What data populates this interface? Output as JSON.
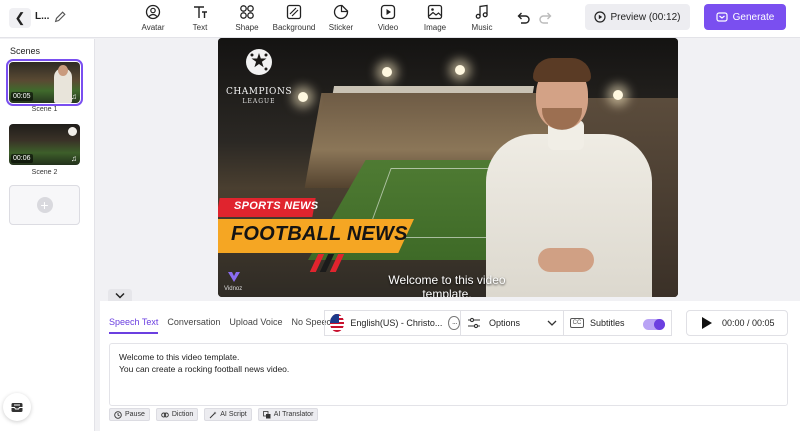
{
  "header": {
    "back_icon": "chevron-left-icon",
    "project_title": "L...",
    "tools": [
      {
        "label": "Avatar",
        "icon": "avatar-icon"
      },
      {
        "label": "Text",
        "icon": "text-icon"
      },
      {
        "label": "Shape",
        "icon": "shape-icon"
      },
      {
        "label": "Background",
        "icon": "background-icon"
      },
      {
        "label": "Sticker",
        "icon": "sticker-icon"
      },
      {
        "label": "Video",
        "icon": "video-icon"
      },
      {
        "label": "Image",
        "icon": "image-icon"
      },
      {
        "label": "Music",
        "icon": "music-icon"
      }
    ],
    "preview_label": "Preview (00:12)",
    "generate_label": "Generate"
  },
  "scenes": {
    "title": "Scenes",
    "items": [
      {
        "label": "Scene 1",
        "duration": "00:05",
        "selected": true
      },
      {
        "label": "Scene 2",
        "duration": "00:06",
        "selected": false
      }
    ]
  },
  "canvas": {
    "logo_title": "CHAMPIONS",
    "logo_subtitle": "LEAGUE",
    "banner_small": "SPORTS NEWS",
    "banner_large": "FOOTBALL NEWS",
    "watermark": "Vidnoz",
    "caption": "Welcome to this video template."
  },
  "panel": {
    "tabs": [
      "Speech Text",
      "Conversation",
      "Upload Voice",
      "No Speech"
    ],
    "active_tab": "Speech Text",
    "voice_label": "English(US) - Christo...",
    "options_label": "Options",
    "subtitles_label": "Subtitles",
    "subtitles_enabled": true,
    "playback_time": "00:00 / 00:05",
    "script_lines": [
      "Welcome to this video template.",
      "You can create a rocking football news video."
    ],
    "actions": [
      "Pause",
      "Diction",
      "AI Script",
      "AI Translator"
    ]
  },
  "colors": {
    "accent": "#7a4ff0",
    "banner_red": "#e0242e",
    "banner_orange": "#f5a623"
  }
}
